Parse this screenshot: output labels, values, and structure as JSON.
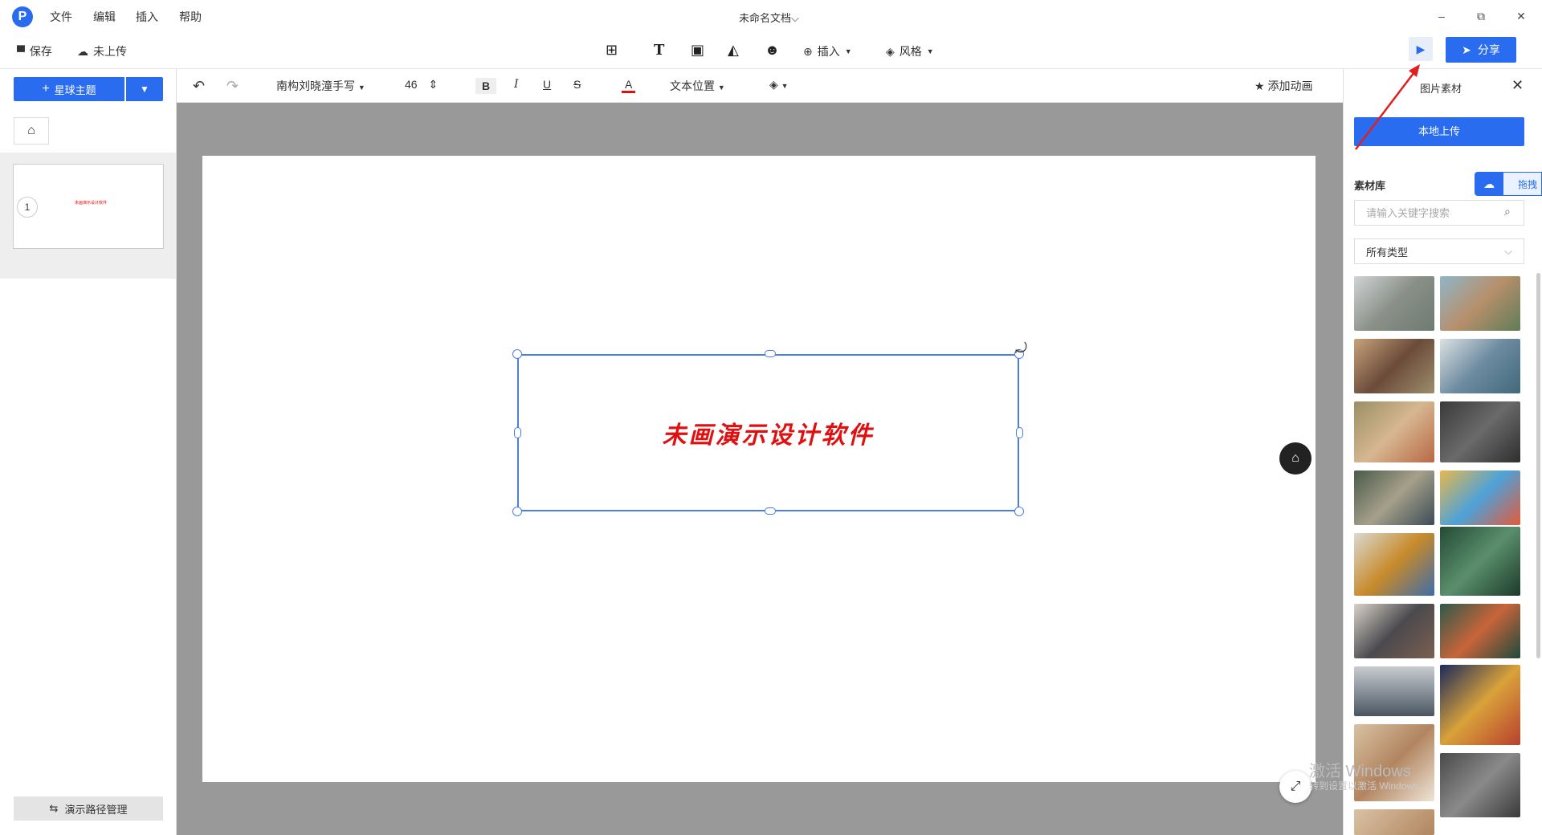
{
  "app": {
    "logo_letter": "P",
    "doc_title": "未命名文档"
  },
  "menu": {
    "file": "文件",
    "edit": "编辑",
    "insert": "插入",
    "help": "帮助"
  },
  "window": {
    "minimize": "–",
    "restore": "⧉",
    "close": "✕"
  },
  "toolbar": {
    "save": "保存",
    "upload_status": "未上传",
    "insert": "插入",
    "style": "风格",
    "share": "分享"
  },
  "left": {
    "theme_button": "星球主题",
    "slide_number": "1",
    "path_button": "演示路径管理"
  },
  "format": {
    "font_name": "南构刘晓潼手写",
    "font_size": "46",
    "bold": "B",
    "italic": "I",
    "underline": "U",
    "strike": "S",
    "font_color": "A",
    "text_position": "文本位置",
    "add_animation": "添加动画"
  },
  "slide": {
    "text": "未画演示设计软件"
  },
  "right": {
    "title": "图片素材",
    "upload_button": "本地上传",
    "library_label": "素材库",
    "drag_label": "拖拽",
    "search_placeholder": "请输入关键字搜索",
    "type_filter": "所有类型"
  },
  "watermark": {
    "line1": "激活 Windows",
    "line2": "转到设置以激活 Windows。"
  },
  "colors": {
    "accent": "#2a6cf0",
    "slide_text": "#e01010",
    "canvas_bg": "#999999"
  }
}
